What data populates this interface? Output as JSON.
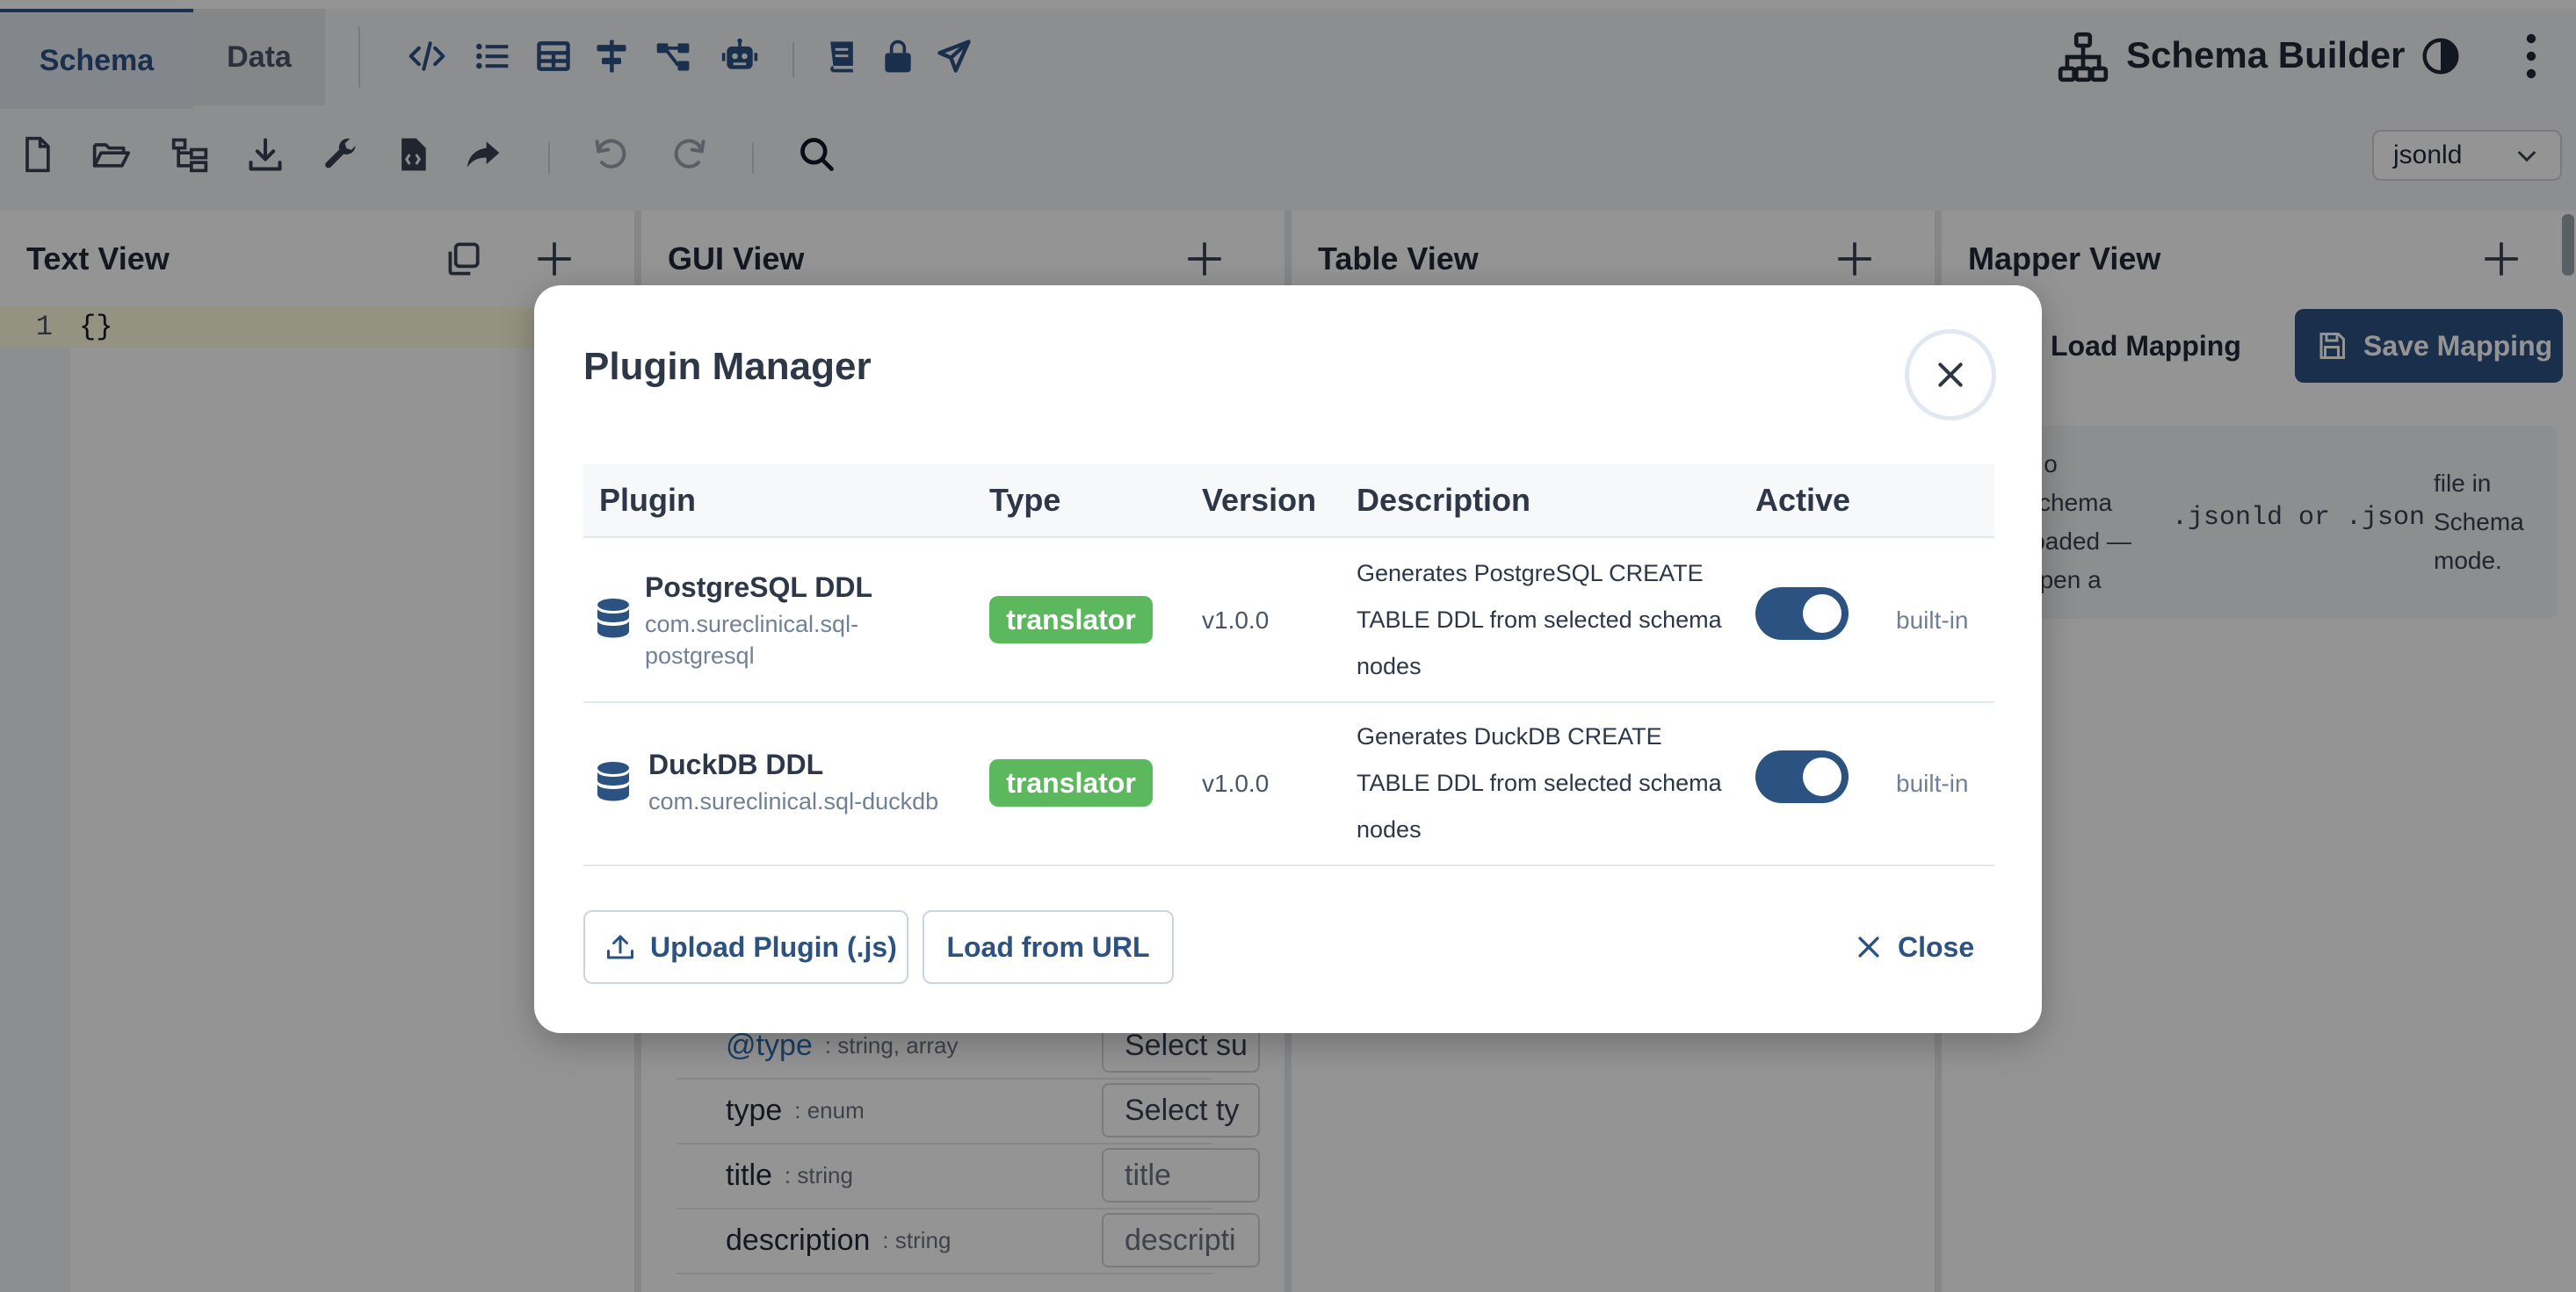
{
  "tabs": [
    {
      "label": "Schema"
    },
    {
      "label": "Data"
    }
  ],
  "app": {
    "title": "Schema Builder"
  },
  "toolbar_icons": [
    "code-icon",
    "list-icon",
    "table-icon",
    "align-icon",
    "tree-icon",
    "robot-icon",
    "book-icon",
    "lock-icon",
    "send-icon"
  ],
  "toolbar2_icons": [
    "new-file-icon",
    "open-folder-icon",
    "tree-view-icon",
    "download-icon",
    "wrench-icon",
    "code-file-icon",
    "redo-arrow-icon",
    "undo-icon",
    "redo-icon",
    "search-icon"
  ],
  "format_select": {
    "value": "jsonld"
  },
  "panels": {
    "text": {
      "title": "Text View",
      "line_number": "1",
      "content": "{}"
    },
    "gui": {
      "title": "GUI View",
      "rows": [
        {
          "label": "@type",
          "type": ": string, array",
          "input": "Select su"
        },
        {
          "label": "type",
          "type": ": enum",
          "input": "Select ty"
        },
        {
          "label": "title",
          "type": ": string",
          "input": "title"
        },
        {
          "label": "description",
          "type": ": string",
          "input": "descripti"
        }
      ]
    },
    "table": {
      "title": "Table View"
    },
    "mapper": {
      "title": "Mapper View",
      "load_label": "Load Mapping",
      "save_label": "Save Mapping",
      "message_parts": [
        "No schema loaded — open a",
        ".jsonld or .json",
        "file in Schema mode."
      ]
    }
  },
  "modal": {
    "title": "Plugin Manager",
    "columns": [
      "Plugin",
      "Type",
      "Version",
      "Description",
      "Active"
    ],
    "plugins": [
      {
        "name": "PostgreSQL DDL",
        "id": "com.sureclinical.sql-postgresql",
        "type": "translator",
        "version": "v1.0.0",
        "description": "Generates PostgreSQL CREATE TABLE DDL from selected schema nodes",
        "active": true,
        "source": "built-in"
      },
      {
        "name": "DuckDB DDL",
        "id": "com.sureclinical.sql-duckdb",
        "type": "translator",
        "version": "v1.0.0",
        "description": "Generates DuckDB CREATE TABLE DDL from selected schema nodes",
        "active": true,
        "source": "built-in"
      }
    ],
    "upload_label": "Upload Plugin (.js)",
    "load_url_label": "Load from URL",
    "close_label": "Close"
  },
  "colors": {
    "accent": "#2c5282",
    "badge": "#5cb85c",
    "overlay": "rgba(0,0,0,0.42)"
  }
}
